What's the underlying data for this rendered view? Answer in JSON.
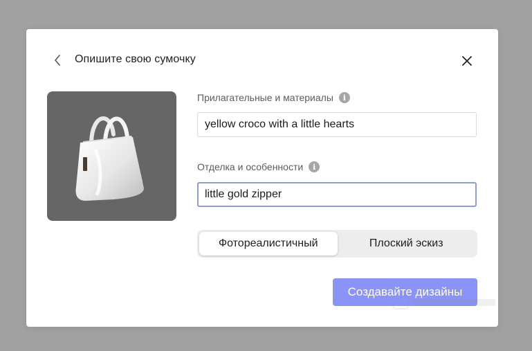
{
  "dialog": {
    "title": "Опишите свою сумочку",
    "back_icon": "chevron-left-icon",
    "close_icon": "close-icon"
  },
  "preview": {
    "subject": "bag-illustration",
    "background_color": "#666666"
  },
  "fields": {
    "adjectives": {
      "label": "Прилагательные и материалы",
      "value": "yellow croco with a little hearts",
      "info_icon": "info-icon"
    },
    "details": {
      "label": "Отделка и особенности",
      "value": "little gold zipper",
      "info_icon": "info-icon"
    }
  },
  "style_toggle": {
    "options": [
      "Фотореалистичный",
      "Плоский эскиз"
    ],
    "selected": "Фотореалистичный"
  },
  "actions": {
    "create_label": "Создавайте дизайны"
  },
  "colors": {
    "backdrop": "#a1a1a1",
    "primary_button": "#8a93f7",
    "focus_border": "#8f9ec9"
  }
}
